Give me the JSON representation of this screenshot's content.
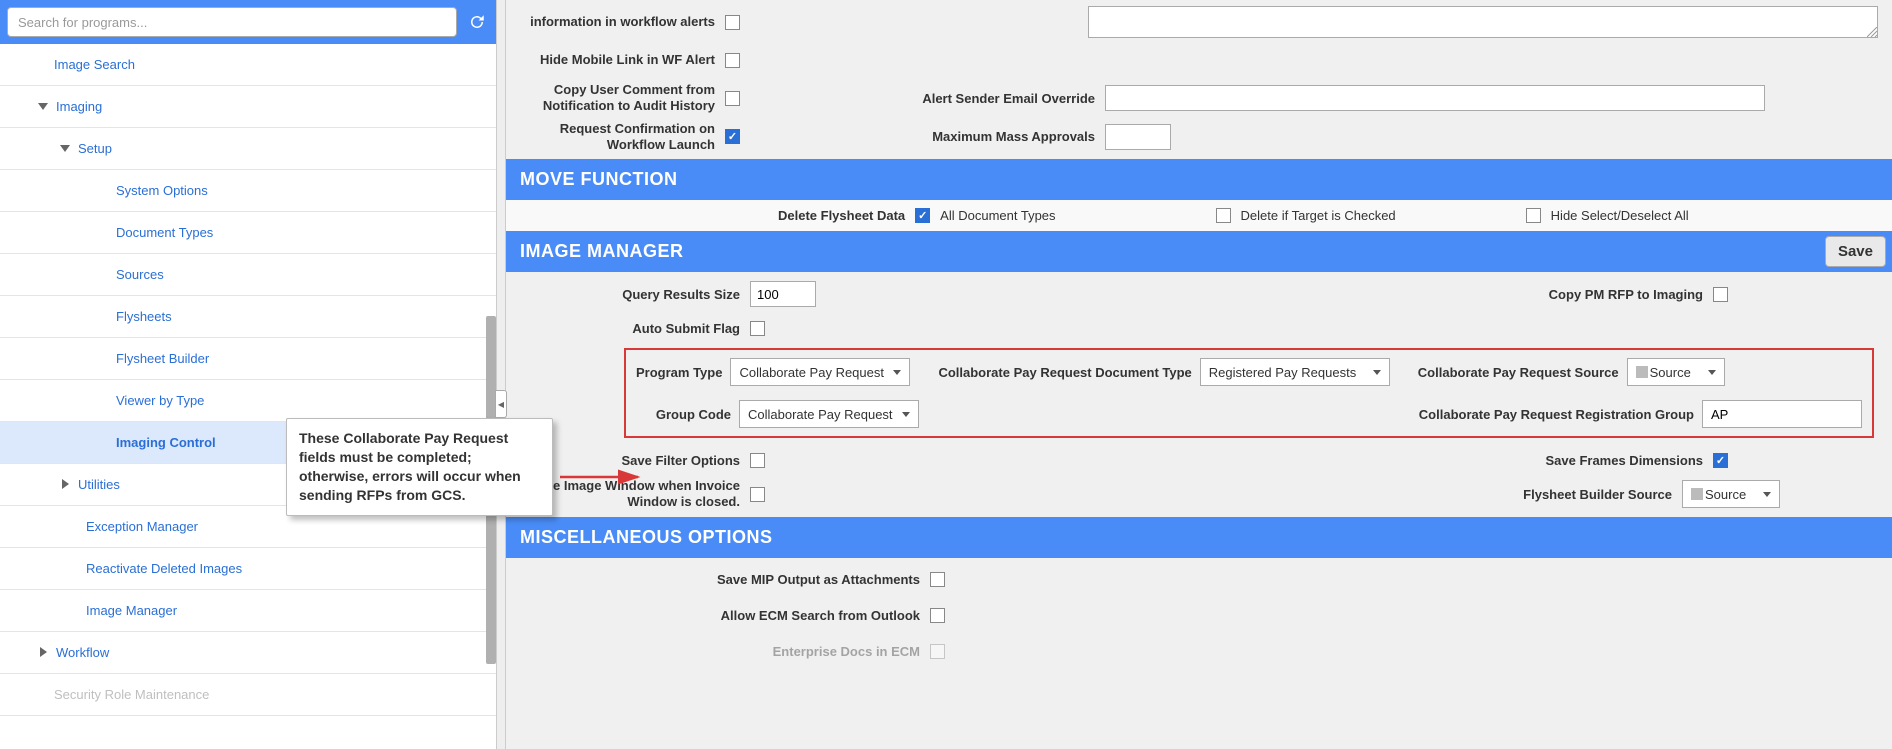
{
  "search": {
    "placeholder": "Search for programs..."
  },
  "sidebar": {
    "image_search": "Image Search",
    "imaging": "Imaging",
    "setup": "Setup",
    "system_options": "System Options",
    "document_types": "Document Types",
    "sources": "Sources",
    "flysheets": "Flysheets",
    "flysheet_builder": "Flysheet Builder",
    "viewer_by_type": "Viewer by Type",
    "imaging_control": "Imaging Control",
    "utilities": "Utilities",
    "exception_manager": "Exception Manager",
    "reactivate_deleted": "Reactivate Deleted Images",
    "image_manager": "Image Manager",
    "workflow": "Workflow",
    "security_role": "Security Role Maintenance"
  },
  "callout": "These Collaborate Pay Request fields must be completed; otherwise, errors will occur when sending RFPs from GCS.",
  "top": {
    "info_wf_alerts": "information in workflow alerts",
    "hide_mobile": "Hide Mobile Link in WF Alert",
    "copy_user_comment": "Copy User Comment from Notification to Audit History",
    "alert_sender": "Alert Sender Email Override",
    "request_confirmation": "Request Confirmation on Workflow Launch",
    "max_mass_approvals": "Maximum Mass Approvals"
  },
  "move": {
    "header": "MOVE FUNCTION",
    "delete_flysheet": "Delete Flysheet Data",
    "all_doc_types": "All Document Types",
    "delete_if_target": "Delete if Target is Checked",
    "hide_select": "Hide Select/Deselect All"
  },
  "im": {
    "header": "IMAGE MANAGER",
    "save": "Save",
    "query_results_size": "Query Results Size",
    "query_results_value": "100",
    "copy_pm_rfp": "Copy PM RFP to Imaging",
    "auto_submit": "Auto Submit Flag",
    "program_type": "Program Type",
    "program_type_value": "Collaborate Pay Request",
    "doc_type_label": "Collaborate Pay Request Document Type",
    "doc_type_value": "Registered Pay Requests",
    "source_label": "Collaborate Pay Request Source",
    "source_value": "Source",
    "group_code": "Group Code",
    "group_code_value": "Collaborate Pay Request",
    "reg_group_label": "Collaborate Pay Request Registration Group",
    "reg_group_value": "AP",
    "save_filter": "Save Filter Options",
    "save_frames": "Save Frames Dimensions",
    "close_image_window": "Close Image Window when Invoice Window is closed.",
    "flysheet_builder_source": "Flysheet Builder Source",
    "flysheet_builder_value": "Source"
  },
  "misc": {
    "header": "MISCELLANEOUS OPTIONS",
    "save_mip": "Save MIP Output as Attachments",
    "allow_ecm": "Allow ECM Search from Outlook",
    "enterprise_docs": "Enterprise Docs in ECM"
  }
}
